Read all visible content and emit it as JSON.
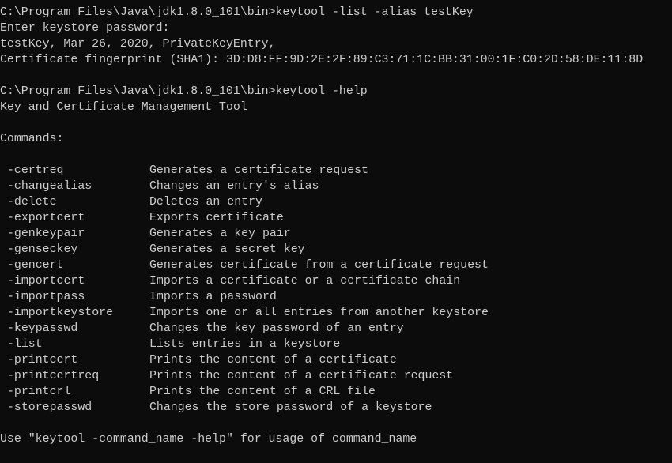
{
  "prompt1": "C:\\Program Files\\Java\\jdk1.8.0_101\\bin>keytool -list -alias testKey",
  "password_prompt": "Enter keystore password:",
  "entry_line": "testKey, Mar 26, 2020, PrivateKeyEntry,",
  "fingerprint_line": "Certificate fingerprint (SHA1): 3D:D8:FF:9D:2E:2F:89:C3:71:1C:BB:31:00:1F:C0:2D:58:DE:11:8D",
  "prompt2": "C:\\Program Files\\Java\\jdk1.8.0_101\\bin>keytool -help",
  "tool_title": "Key and Certificate Management Tool",
  "commands_header": "Commands:",
  "commands": [
    {
      "name": "-certreq",
      "desc": "Generates a certificate request"
    },
    {
      "name": "-changealias",
      "desc": "Changes an entry's alias"
    },
    {
      "name": "-delete",
      "desc": "Deletes an entry"
    },
    {
      "name": "-exportcert",
      "desc": "Exports certificate"
    },
    {
      "name": "-genkeypair",
      "desc": "Generates a key pair"
    },
    {
      "name": "-genseckey",
      "desc": "Generates a secret key"
    },
    {
      "name": "-gencert",
      "desc": "Generates certificate from a certificate request"
    },
    {
      "name": "-importcert",
      "desc": "Imports a certificate or a certificate chain"
    },
    {
      "name": "-importpass",
      "desc": "Imports a password"
    },
    {
      "name": "-importkeystore",
      "desc": "Imports one or all entries from another keystore"
    },
    {
      "name": "-keypasswd",
      "desc": "Changes the key password of an entry"
    },
    {
      "name": "-list",
      "desc": "Lists entries in a keystore"
    },
    {
      "name": "-printcert",
      "desc": "Prints the content of a certificate"
    },
    {
      "name": "-printcertreq",
      "desc": "Prints the content of a certificate request"
    },
    {
      "name": "-printcrl",
      "desc": "Prints the content of a CRL file"
    },
    {
      "name": "-storepasswd",
      "desc": "Changes the store password of a keystore"
    }
  ],
  "usage_line": "Use \"keytool -command_name -help\" for usage of command_name",
  "colors": {
    "background": "#0c0c0c",
    "foreground": "#cccccc"
  }
}
